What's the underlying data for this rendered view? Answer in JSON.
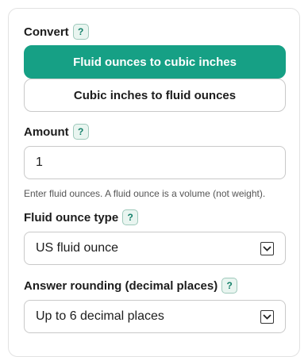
{
  "convert": {
    "label": "Convert",
    "help": "?",
    "options": [
      {
        "label": "Fluid ounces to cubic inches",
        "active": true
      },
      {
        "label": "Cubic inches to fluid ounces",
        "active": false
      }
    ]
  },
  "amount": {
    "label": "Amount",
    "help": "?",
    "value": "1",
    "hint": "Enter fluid ounces. A fluid ounce is a volume (not weight)."
  },
  "fluid_ounce_type": {
    "label": "Fluid ounce type",
    "help": "?",
    "selected": "US fluid ounce"
  },
  "rounding": {
    "label": "Answer rounding (decimal places)",
    "help": "?",
    "selected": "Up to 6 decimal places"
  },
  "colors": {
    "accent": "#16a085",
    "help_text": "#14806a"
  }
}
